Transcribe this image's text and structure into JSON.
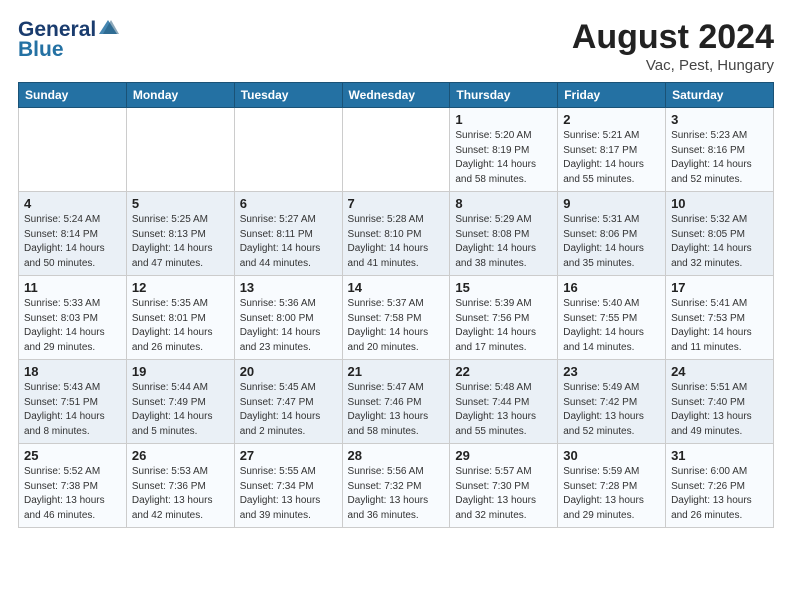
{
  "header": {
    "logo_general": "General",
    "logo_blue": "Blue",
    "month_year": "August 2024",
    "location": "Vac, Pest, Hungary"
  },
  "weekdays": [
    "Sunday",
    "Monday",
    "Tuesday",
    "Wednesday",
    "Thursday",
    "Friday",
    "Saturday"
  ],
  "weeks": [
    [
      {
        "day": "",
        "info": ""
      },
      {
        "day": "",
        "info": ""
      },
      {
        "day": "",
        "info": ""
      },
      {
        "day": "",
        "info": ""
      },
      {
        "day": "1",
        "info": "Sunrise: 5:20 AM\nSunset: 8:19 PM\nDaylight: 14 hours\nand 58 minutes."
      },
      {
        "day": "2",
        "info": "Sunrise: 5:21 AM\nSunset: 8:17 PM\nDaylight: 14 hours\nand 55 minutes."
      },
      {
        "day": "3",
        "info": "Sunrise: 5:23 AM\nSunset: 8:16 PM\nDaylight: 14 hours\nand 52 minutes."
      }
    ],
    [
      {
        "day": "4",
        "info": "Sunrise: 5:24 AM\nSunset: 8:14 PM\nDaylight: 14 hours\nand 50 minutes."
      },
      {
        "day": "5",
        "info": "Sunrise: 5:25 AM\nSunset: 8:13 PM\nDaylight: 14 hours\nand 47 minutes."
      },
      {
        "day": "6",
        "info": "Sunrise: 5:27 AM\nSunset: 8:11 PM\nDaylight: 14 hours\nand 44 minutes."
      },
      {
        "day": "7",
        "info": "Sunrise: 5:28 AM\nSunset: 8:10 PM\nDaylight: 14 hours\nand 41 minutes."
      },
      {
        "day": "8",
        "info": "Sunrise: 5:29 AM\nSunset: 8:08 PM\nDaylight: 14 hours\nand 38 minutes."
      },
      {
        "day": "9",
        "info": "Sunrise: 5:31 AM\nSunset: 8:06 PM\nDaylight: 14 hours\nand 35 minutes."
      },
      {
        "day": "10",
        "info": "Sunrise: 5:32 AM\nSunset: 8:05 PM\nDaylight: 14 hours\nand 32 minutes."
      }
    ],
    [
      {
        "day": "11",
        "info": "Sunrise: 5:33 AM\nSunset: 8:03 PM\nDaylight: 14 hours\nand 29 minutes."
      },
      {
        "day": "12",
        "info": "Sunrise: 5:35 AM\nSunset: 8:01 PM\nDaylight: 14 hours\nand 26 minutes."
      },
      {
        "day": "13",
        "info": "Sunrise: 5:36 AM\nSunset: 8:00 PM\nDaylight: 14 hours\nand 23 minutes."
      },
      {
        "day": "14",
        "info": "Sunrise: 5:37 AM\nSunset: 7:58 PM\nDaylight: 14 hours\nand 20 minutes."
      },
      {
        "day": "15",
        "info": "Sunrise: 5:39 AM\nSunset: 7:56 PM\nDaylight: 14 hours\nand 17 minutes."
      },
      {
        "day": "16",
        "info": "Sunrise: 5:40 AM\nSunset: 7:55 PM\nDaylight: 14 hours\nand 14 minutes."
      },
      {
        "day": "17",
        "info": "Sunrise: 5:41 AM\nSunset: 7:53 PM\nDaylight: 14 hours\nand 11 minutes."
      }
    ],
    [
      {
        "day": "18",
        "info": "Sunrise: 5:43 AM\nSunset: 7:51 PM\nDaylight: 14 hours\nand 8 minutes."
      },
      {
        "day": "19",
        "info": "Sunrise: 5:44 AM\nSunset: 7:49 PM\nDaylight: 14 hours\nand 5 minutes."
      },
      {
        "day": "20",
        "info": "Sunrise: 5:45 AM\nSunset: 7:47 PM\nDaylight: 14 hours\nand 2 minutes."
      },
      {
        "day": "21",
        "info": "Sunrise: 5:47 AM\nSunset: 7:46 PM\nDaylight: 13 hours\nand 58 minutes."
      },
      {
        "day": "22",
        "info": "Sunrise: 5:48 AM\nSunset: 7:44 PM\nDaylight: 13 hours\nand 55 minutes."
      },
      {
        "day": "23",
        "info": "Sunrise: 5:49 AM\nSunset: 7:42 PM\nDaylight: 13 hours\nand 52 minutes."
      },
      {
        "day": "24",
        "info": "Sunrise: 5:51 AM\nSunset: 7:40 PM\nDaylight: 13 hours\nand 49 minutes."
      }
    ],
    [
      {
        "day": "25",
        "info": "Sunrise: 5:52 AM\nSunset: 7:38 PM\nDaylight: 13 hours\nand 46 minutes."
      },
      {
        "day": "26",
        "info": "Sunrise: 5:53 AM\nSunset: 7:36 PM\nDaylight: 13 hours\nand 42 minutes."
      },
      {
        "day": "27",
        "info": "Sunrise: 5:55 AM\nSunset: 7:34 PM\nDaylight: 13 hours\nand 39 minutes."
      },
      {
        "day": "28",
        "info": "Sunrise: 5:56 AM\nSunset: 7:32 PM\nDaylight: 13 hours\nand 36 minutes."
      },
      {
        "day": "29",
        "info": "Sunrise: 5:57 AM\nSunset: 7:30 PM\nDaylight: 13 hours\nand 32 minutes."
      },
      {
        "day": "30",
        "info": "Sunrise: 5:59 AM\nSunset: 7:28 PM\nDaylight: 13 hours\nand 29 minutes."
      },
      {
        "day": "31",
        "info": "Sunrise: 6:00 AM\nSunset: 7:26 PM\nDaylight: 13 hours\nand 26 minutes."
      }
    ]
  ]
}
